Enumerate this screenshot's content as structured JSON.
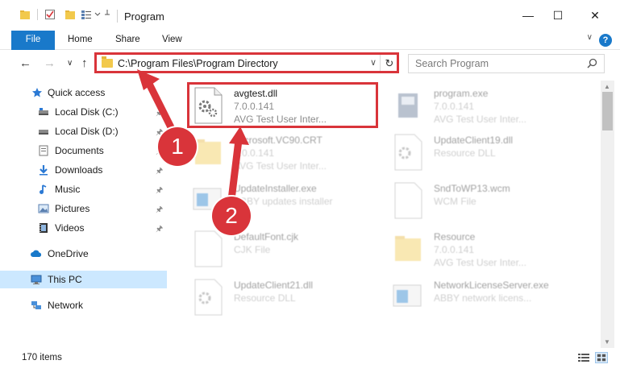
{
  "window": {
    "title": "Program",
    "minimize_glyph": "—",
    "maximize_glyph": "☐",
    "close_glyph": "✕"
  },
  "ribbon": {
    "tabs": [
      "File",
      "Home",
      "Share",
      "View"
    ],
    "help_glyph": "?",
    "chevron_glyph": "∨"
  },
  "navigation": {
    "back_glyph": "←",
    "forward_glyph": "→",
    "recent_glyph": "∨",
    "up_glyph": "↑"
  },
  "address": {
    "path": "C:\\Program Files\\Program Directory",
    "dropdown_glyph": "∨",
    "refresh_glyph": "↻"
  },
  "search": {
    "placeholder": "Search Program"
  },
  "sidebar": {
    "items": [
      {
        "label": "Quick access",
        "icon": "star-icon"
      },
      {
        "label": "Local Disk (C:)",
        "icon": "drive-icon"
      },
      {
        "label": "Local Disk (D:)",
        "icon": "drive-icon"
      },
      {
        "label": "Documents",
        "icon": "documents-icon"
      },
      {
        "label": "Downloads",
        "icon": "download-icon"
      },
      {
        "label": "Music",
        "icon": "music-icon"
      },
      {
        "label": "Pictures",
        "icon": "pictures-icon"
      },
      {
        "label": "Videos",
        "icon": "video-icon"
      },
      {
        "label": "OneDrive",
        "icon": "cloud-icon"
      },
      {
        "label": "This PC",
        "icon": "computer-icon"
      },
      {
        "label": "Network",
        "icon": "network-icon"
      }
    ],
    "pin_glyph": "📌"
  },
  "files": [
    {
      "name": "avgtest.dll",
      "line2": "7.0.0.141",
      "line3": "AVG Test User Inter...",
      "icon": "dll-icon",
      "highlighted": true
    },
    {
      "name": "program.exe",
      "line2": "7.0.0.141",
      "line3": "AVG Test User Inter...",
      "icon": "exe-icon",
      "highlighted": false
    },
    {
      "name": "Microsoft.VC90.CRT",
      "line2": "7.0.0.141",
      "line3": "AVG Test User Inter...",
      "icon": "folder-icon",
      "highlighted": false
    },
    {
      "name": "UpdateClient19.dll",
      "line2": "Resource DLL",
      "line3": "",
      "icon": "dll-icon",
      "highlighted": false
    },
    {
      "name": "UpdateInstaller.exe",
      "line2": "ABBY updates installer",
      "line3": "",
      "icon": "installer-icon",
      "highlighted": false
    },
    {
      "name": "SndToWP13.wcm",
      "line2": "WCM File",
      "line3": "",
      "icon": "file-icon",
      "highlighted": false
    },
    {
      "name": "DefaultFont.cjk",
      "line2": "CJK File",
      "line3": "",
      "icon": "file-icon",
      "highlighted": false
    },
    {
      "name": "Resource",
      "line2": "7.0.0.141",
      "line3": "AVG Test User Inter...",
      "icon": "folder-icon",
      "highlighted": false
    },
    {
      "name": "UpdateClient21.dll",
      "line2": "Resource DLL",
      "line3": "",
      "icon": "dll-icon",
      "highlighted": false
    },
    {
      "name": "NetworkLicenseServer.exe",
      "line2": "ABBY network licens...",
      "line3": "",
      "icon": "server-icon",
      "highlighted": false
    }
  ],
  "status": {
    "item_count": "170 items"
  },
  "annotations": {
    "step1": "1",
    "step2": "2",
    "color": "#d9343a"
  },
  "colors": {
    "accent": "#1979ca",
    "selection": "#cce8ff",
    "annotation_red": "#d9343a"
  }
}
